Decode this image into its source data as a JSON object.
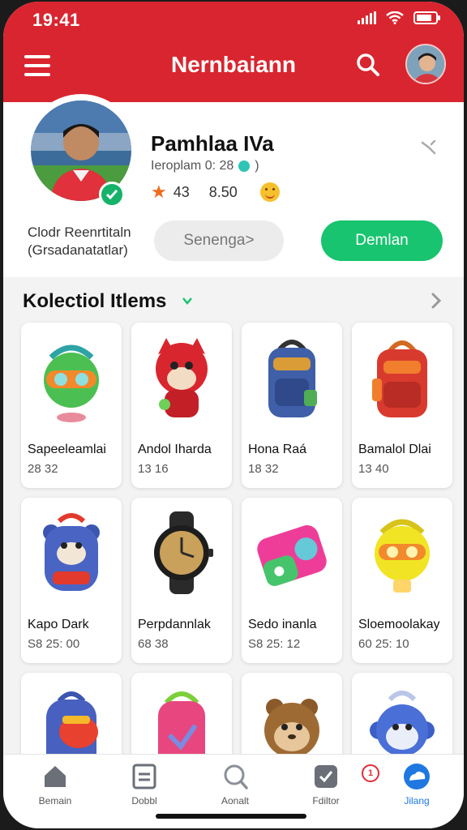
{
  "status_bar": {
    "time": "19:41"
  },
  "header": {
    "title": "Nernbaiann",
    "menu_icon": "menu-icon",
    "search_icon": "search-icon",
    "avatar_icon": "avatar"
  },
  "profile": {
    "name": "Pamhlaa IVa",
    "subtitle": "Ieroplam 0: 28",
    "subtitle_suffix": ")",
    "rating": "43",
    "score": "8.50",
    "caption_line1": "Clodr Reenrtitaln",
    "caption_line2": "(Grsadanatatlar)",
    "secondary_button": "Senenga>",
    "primary_button": "Demlan",
    "colors": {
      "brand": "#d9252f",
      "accent": "#18c46f"
    }
  },
  "collection": {
    "title": "Kolectiol Itlems",
    "items": [
      {
        "name": "Sapeeleamlai",
        "meta": "28 32"
      },
      {
        "name": "Andol Iharda",
        "meta": "13 16"
      },
      {
        "name": "Hona Raá",
        "meta": "18 32"
      },
      {
        "name": "Bamalol Dlai",
        "meta": "13 40"
      },
      {
        "name": "Kapo Dark",
        "meta": "S8 25: 00"
      },
      {
        "name": "Perpdannlak",
        "meta": "68 38"
      },
      {
        "name": "Sedo inanla",
        "meta": "S8 25: 12"
      },
      {
        "name": "Sloemoolakay",
        "meta": "60 25: 10"
      },
      {
        "name": "",
        "meta": ""
      },
      {
        "name": "",
        "meta": ""
      },
      {
        "name": "",
        "meta": ""
      },
      {
        "name": "",
        "meta": ""
      }
    ]
  },
  "bottom_nav": {
    "items": [
      {
        "label": "Bemain",
        "icon": "home-icon"
      },
      {
        "label": "Dobbl",
        "icon": "document-icon"
      },
      {
        "label": "Aonalt",
        "icon": "search-icon"
      },
      {
        "label": "Fdiltor",
        "icon": "check-icon"
      },
      {
        "label": "Jilang",
        "icon": "cloud-icon"
      }
    ],
    "badge": "1"
  }
}
